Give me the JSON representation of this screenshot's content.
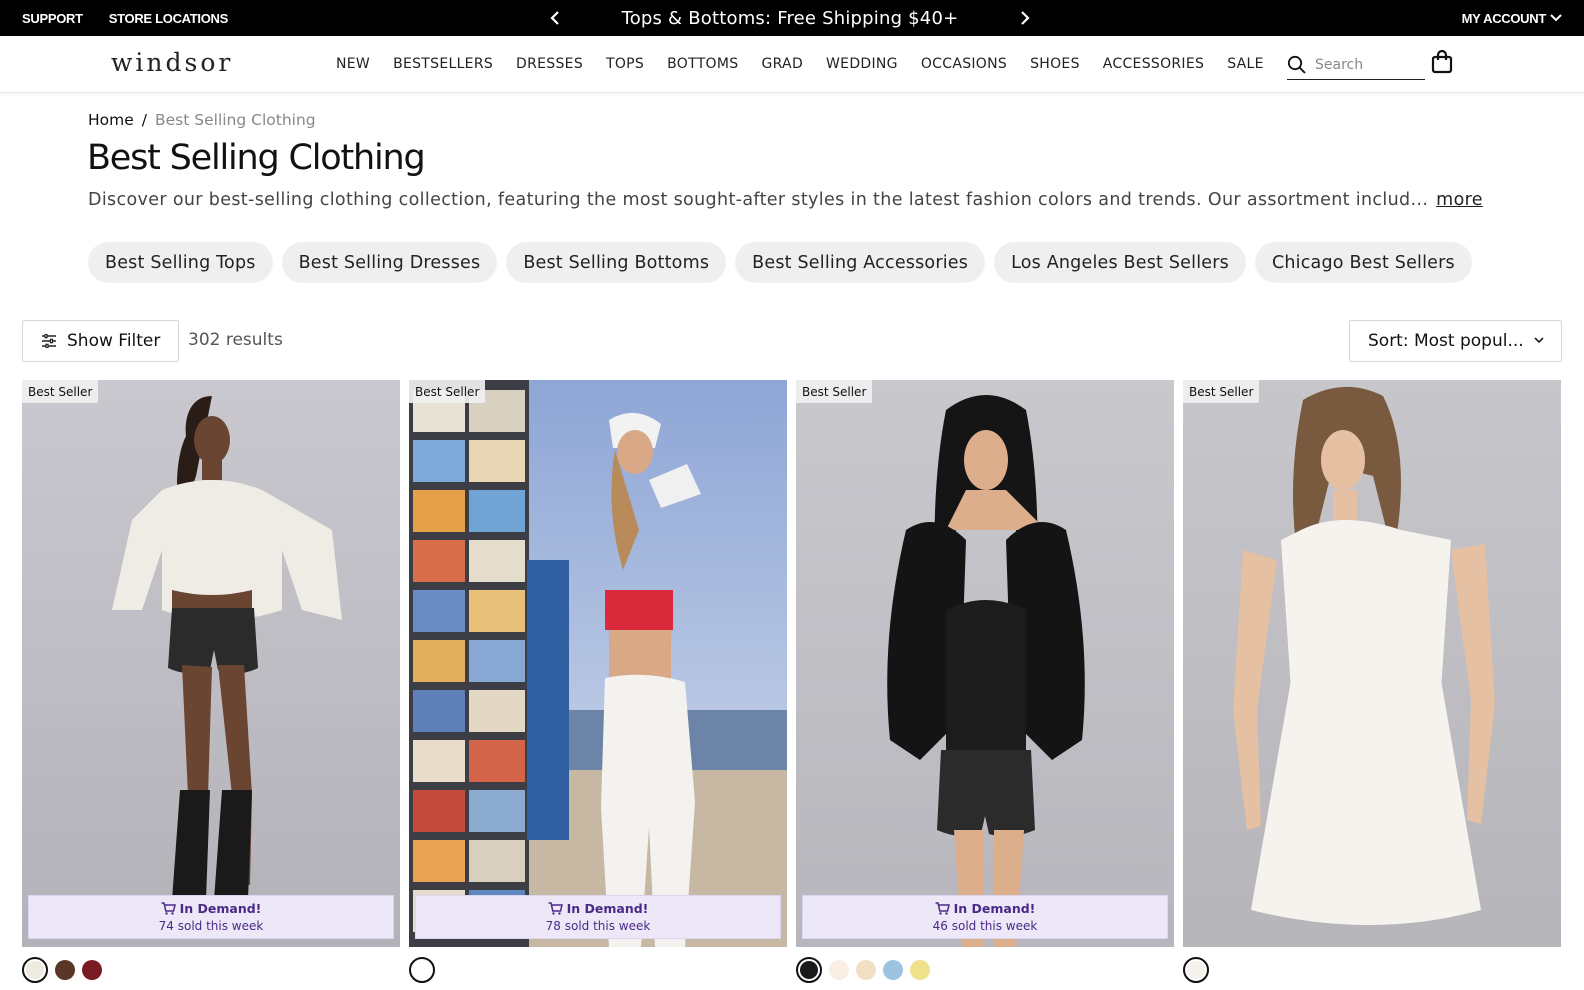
{
  "topbar": {
    "support": "SUPPORT",
    "store_locations": "STORE LOCATIONS",
    "promo_text": "Tops & Bottoms: Free Shipping $40+",
    "my_account": "MY ACCOUNT"
  },
  "header": {
    "logo": "windsor",
    "nav": [
      "NEW",
      "BESTSELLERS",
      "DRESSES",
      "TOPS",
      "BOTTOMS",
      "GRAD",
      "WEDDING",
      "OCCASIONS",
      "SHOES",
      "ACCESSORIES",
      "SALE"
    ],
    "search_placeholder": "Search"
  },
  "breadcrumb": {
    "home": "Home",
    "separator": "/",
    "current": "Best Selling Clothing"
  },
  "page": {
    "title": "Best Selling Clothing",
    "description": "Discover our best-selling clothing collection, featuring the most sought-after styles in the latest fashion colors and trends. Our assortment includ...",
    "more_label": "more"
  },
  "pills": [
    "Best Selling Tops",
    "Best Selling Dresses",
    "Best Selling Bottoms",
    "Best Selling Accessories",
    "Los Angeles Best Sellers",
    "Chicago Best Sellers"
  ],
  "toolbar": {
    "filter_label": "Show Filter",
    "results": "302 results",
    "sort_label": "Sort: Most popul..."
  },
  "products": [
    {
      "badge": "Best Seller",
      "in_demand": "In Demand!",
      "sold": "74 sold this week",
      "colors": [
        "#eeeae0",
        "#5a3626",
        "#7a1a22"
      ]
    },
    {
      "badge": "Best Seller",
      "in_demand": "In Demand!",
      "sold": "78 sold this week",
      "colors": [
        "#ffffff"
      ]
    },
    {
      "badge": "Best Seller",
      "in_demand": "In Demand!",
      "sold": "46 sold this week",
      "colors": [
        "#1a1a1a",
        "#f8eee4",
        "#f1dfc4",
        "#9cc4e0",
        "#efe08a"
      ]
    },
    {
      "badge": "Best Seller",
      "colors": [
        "#f6f3ec"
      ]
    }
  ],
  "colors": {
    "topbar_bg": "#000000",
    "pill_bg": "#efefef",
    "demand_bg": "#ece8f7",
    "demand_text": "#4b2a86"
  }
}
